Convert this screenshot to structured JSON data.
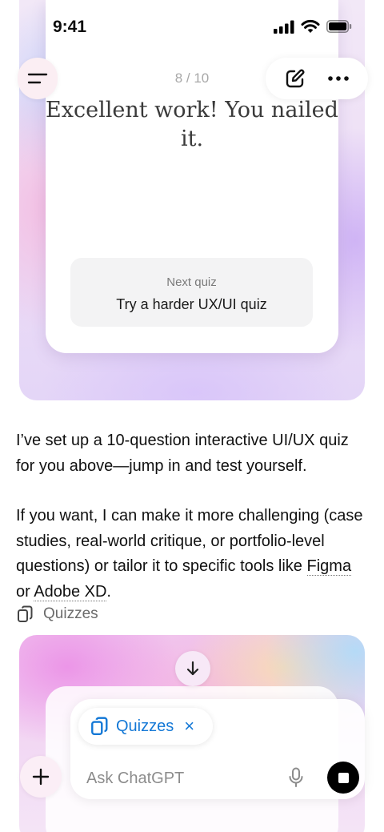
{
  "status_bar": {
    "time": "9:41"
  },
  "header": {
    "menu_icon": "sidebar-menu-icon",
    "new_chat_icon": "edit-icon",
    "more_icon": "ellipsis-icon"
  },
  "quiz_card": {
    "progress": "8 / 10",
    "result_title": "Excellent work! You nailed it.",
    "next_label": "Next quiz",
    "next_title": "Try a harder UX/UI quiz"
  },
  "message": {
    "para1": "I’ve set up a 10-question interactive UI/UX quiz for you above—jump in and test yourself.",
    "para2_a": "If you want, I can make it more challenging (case studies, real-world critique, or portfolio-level questions) or tailor it to specific tools like ",
    "link1": "Figma",
    "para2_or": " or ",
    "link2": "Adobe XD",
    "para2_end": ".",
    "source_label": "Quizzes"
  },
  "composer": {
    "chip_label": "Quizzes",
    "chip_close": "×",
    "placeholder": "Ask ChatGPT"
  },
  "colors": {
    "accent": "#1478d6",
    "stop_button": "#000000"
  }
}
